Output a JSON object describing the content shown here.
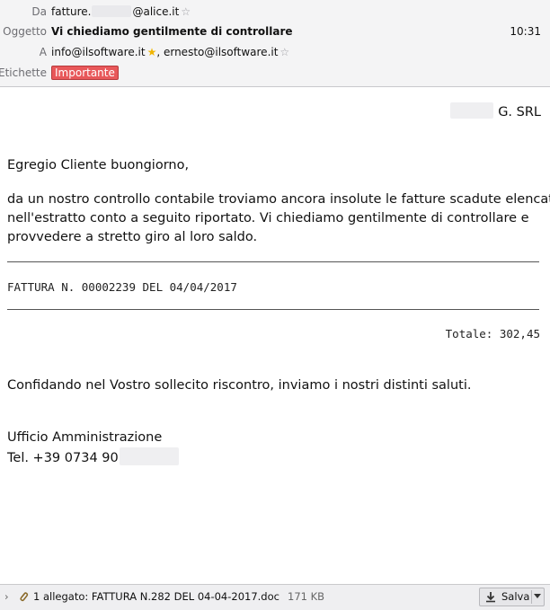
{
  "header": {
    "from": {
      "label": "Da",
      "value_prefix": "fatture.",
      "value_suffix": "@alice.it"
    },
    "subject": {
      "label": "Oggetto",
      "value": "Vi chiediamo gentilmente di controllare",
      "time": "10:31"
    },
    "to": {
      "label": "A",
      "recipient1": "info@ilsoftware.it",
      "separator": ", ",
      "recipient2": "ernesto@ilsoftware.it"
    },
    "tags": {
      "label": "Etichette",
      "tag": "Importante"
    }
  },
  "body": {
    "company": "G. SRL",
    "greeting": "Egregio Cliente buongiorno,",
    "paragraph": [
      "da un nostro controllo contabile troviamo ancora insolute le fatture scadute elencate",
      "nell'estratto conto a seguito riportato. Vi chiediamo gentilmente di controllare e",
      "provvedere a stretto giro al loro saldo."
    ],
    "invoice_line": "FATTURA N. 00002239 DEL 04/04/2017",
    "total": "Totale: 302,45",
    "closing": "Confidando nel Vostro sollecito riscontro, inviamo i nostri distinti saluti.",
    "office": "Ufficio Amministrazione",
    "phone": "Tel. +39 0734 90"
  },
  "footer": {
    "attachment_count": "1 allegato:",
    "attachment_name": "FATTURA N.282 DEL 04-04-2017.doc",
    "attachment_size": "171 KB",
    "save_label": "Salva"
  },
  "colors": {
    "tag_bg": "#e8585a",
    "header_bg": "#f4f4f5",
    "star_gold": "#f0b400"
  }
}
